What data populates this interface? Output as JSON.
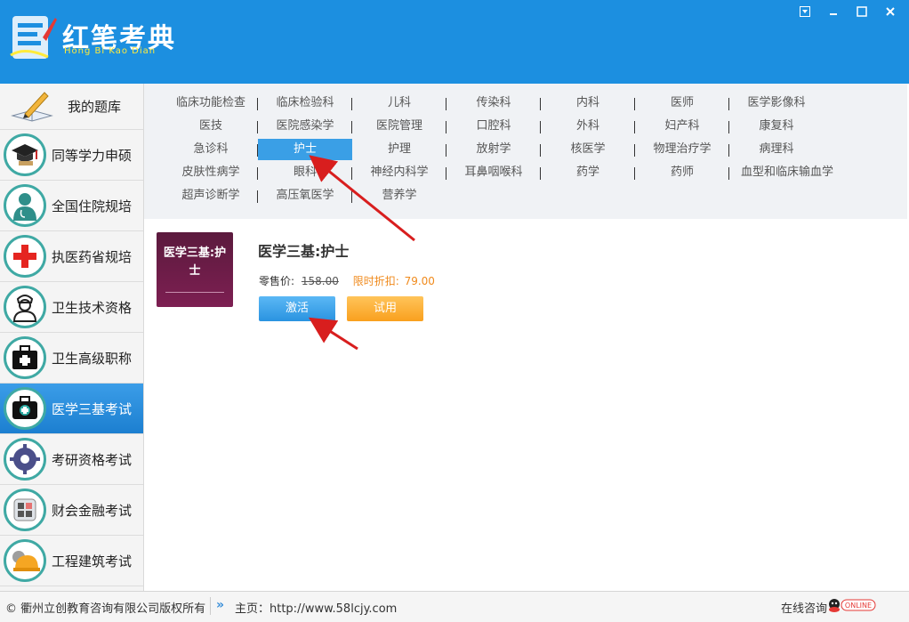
{
  "app": {
    "name_cn": "红笔考典",
    "name_en": "Hong Bi Kao Dian"
  },
  "window": {
    "dropdown_icon": "dropdown-box-icon",
    "minimize_icon": "minimize-icon",
    "maximize_icon": "maximize-icon",
    "close_icon": "close-icon"
  },
  "sidebar": {
    "items": [
      {
        "label": "我的题库",
        "icon": "pen-book-icon"
      },
      {
        "label": "同等学力申硕",
        "icon": "graduation-cap-icon"
      },
      {
        "label": "全国住院规培",
        "icon": "doctor-icon"
      },
      {
        "label": "执医药省规培",
        "icon": "red-cross-icon"
      },
      {
        "label": "卫生技术资格",
        "icon": "nurse-icon"
      },
      {
        "label": "卫生高级职称",
        "icon": "medical-kit-icon"
      },
      {
        "label": "医学三基考试",
        "icon": "medical-bag-icon"
      },
      {
        "label": "考研资格考试",
        "icon": "gear-people-icon"
      },
      {
        "label": "财会金融考试",
        "icon": "calculator-icon"
      },
      {
        "label": "工程建筑考试",
        "icon": "helmet-icon"
      }
    ],
    "active_index": 6
  },
  "categories": {
    "rows": [
      [
        "临床功能检查",
        "临床检验科",
        "儿科",
        "传染科",
        "内科",
        "医师",
        "医学影像科"
      ],
      [
        "医技",
        "医院感染学",
        "医院管理",
        "口腔科",
        "外科",
        "妇产科",
        "康复科"
      ],
      [
        "急诊科",
        "护士",
        "护理",
        "放射学",
        "核医学",
        "物理治疗学",
        "病理科"
      ],
      [
        "皮肤性病学",
        "眼科",
        "神经内科学",
        "耳鼻咽喉科",
        "药学",
        "药师",
        "血型和临床输血学"
      ],
      [
        "超声诊断学",
        "高压氧医学",
        "营养学"
      ]
    ],
    "selected": "护士"
  },
  "product": {
    "cover_text": "医学三基:护士",
    "title": "医学三基:护士",
    "price_label": "零售价:",
    "price_original": "158.00",
    "sale_label": "限时折扣:",
    "sale_price": "79.00",
    "activate_label": "激活",
    "trial_label": "试用"
  },
  "footer": {
    "copyright": "© 衢州立创教育咨询有限公司版权所有",
    "home": "主页：http://www.58lcjy.com",
    "consult": "在线咨询",
    "online_badge": "ONLINE"
  },
  "colors": {
    "titlebar": "#1c8fe0",
    "selected_tab": "#3a9fe6",
    "sale_price": "#f08a1c",
    "annotation_arrow": "#d81e1e"
  }
}
